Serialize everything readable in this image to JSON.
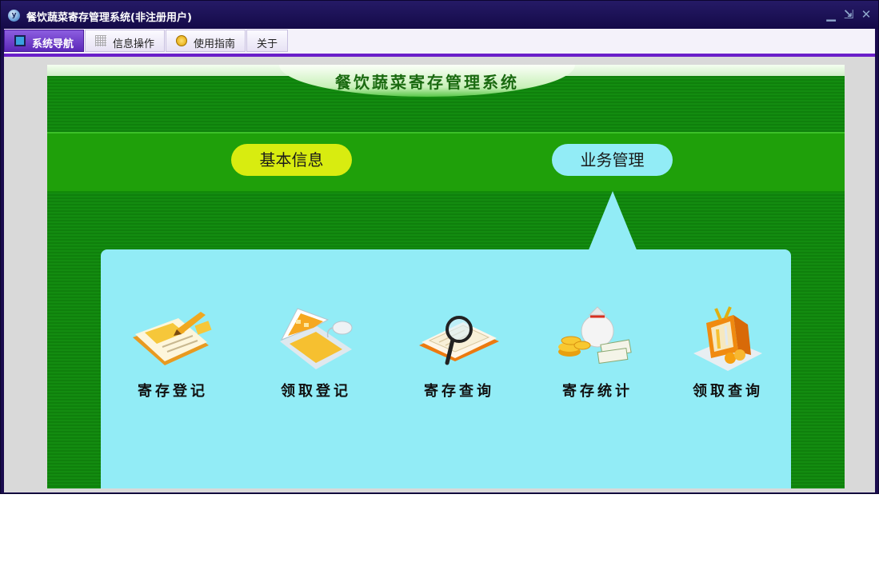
{
  "window": {
    "title": "餐饮蔬菜寄存管理系统(非注册用户)",
    "app_icon": "y"
  },
  "window_controls": [
    "minimize-icon",
    "restore-icon",
    "close-icon"
  ],
  "menu": {
    "tabs": [
      {
        "label": "系统导航",
        "icon": "screen-icon",
        "active": true
      },
      {
        "label": "信息操作",
        "icon": "grid-icon",
        "active": false
      },
      {
        "label": "使用指南",
        "icon": "clock-icon",
        "active": false
      },
      {
        "label": "关于",
        "icon": "",
        "active": false
      }
    ]
  },
  "panel": {
    "title": "餐饮蔬菜寄存管理系统",
    "nav": {
      "basic": "基本信息",
      "business": "业务管理"
    },
    "functions": [
      {
        "label": "寄存登记",
        "icon": "register-book-icon"
      },
      {
        "label": "领取登记",
        "icon": "laptop-icon"
      },
      {
        "label": "寄存查询",
        "icon": "magnifier-icon"
      },
      {
        "label": "寄存统计",
        "icon": "money-bag-icon"
      },
      {
        "label": "领取查询",
        "icon": "gift-box-icon"
      }
    ]
  },
  "colors": {
    "title_bar": "#1a0c4e",
    "menu_accent": "#6a1fc9",
    "panel_green": "#138c10",
    "pill_yellow": "#d8ec10",
    "pill_cyan": "#92ecf6"
  }
}
